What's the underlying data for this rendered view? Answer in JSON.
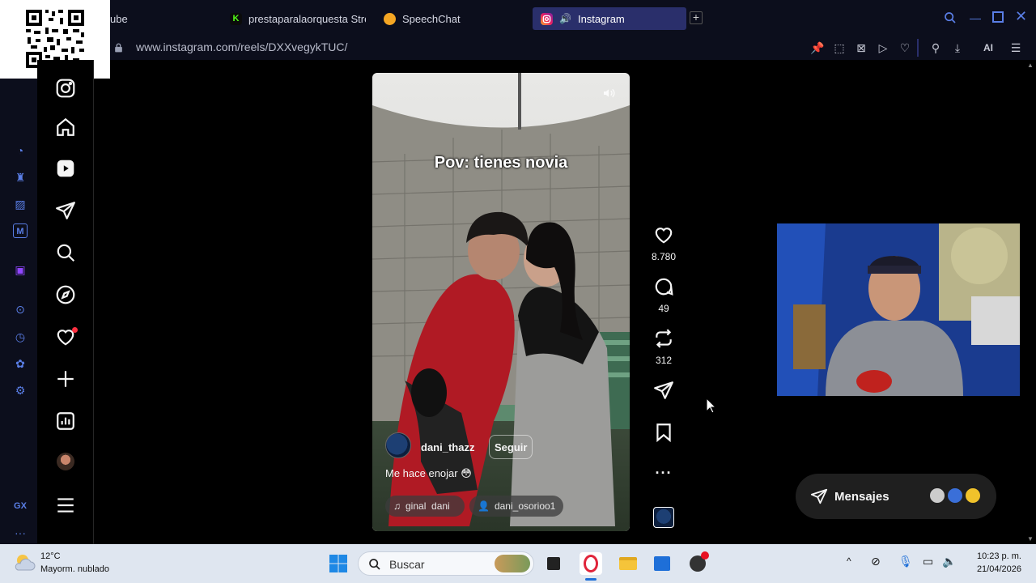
{
  "browser": {
    "tabs": [
      {
        "label": "ube",
        "favicon": "youtube-icon"
      },
      {
        "label": "prestaparalaorquesta Stre",
        "favicon": "kick-icon"
      },
      {
        "label": "SpeechChat",
        "favicon": "speechchat-icon"
      },
      {
        "label": "Instagram",
        "favicon": "instagram-icon",
        "active": true
      }
    ],
    "url": "www.instagram.com/reels/DXXvegykTUC/",
    "ai_label": "AI"
  },
  "opera_sidebar": {
    "gx_label": "GX"
  },
  "reel": {
    "overlay_text": "Pov: tienes novia",
    "username": "dani_thazz",
    "follow_label": "Seguir",
    "description": "Me hace enojar 😳",
    "audio_label": "ginal  dani",
    "tagged_user": "dani_osorioo1"
  },
  "actions": {
    "likes": "8.780",
    "comments": "49",
    "reposts": "312"
  },
  "messages": {
    "label": "Mensajes"
  },
  "taskbar": {
    "weather_temp": "12°C",
    "weather_desc": "Mayorm. nublado",
    "search_placeholder": "Buscar",
    "time": "10:23 p. m.",
    "date": "21/04/2026"
  },
  "colors": {
    "accent": "#2a2f6b",
    "opera": "#5a7ee6",
    "notification": "#ff3040"
  }
}
